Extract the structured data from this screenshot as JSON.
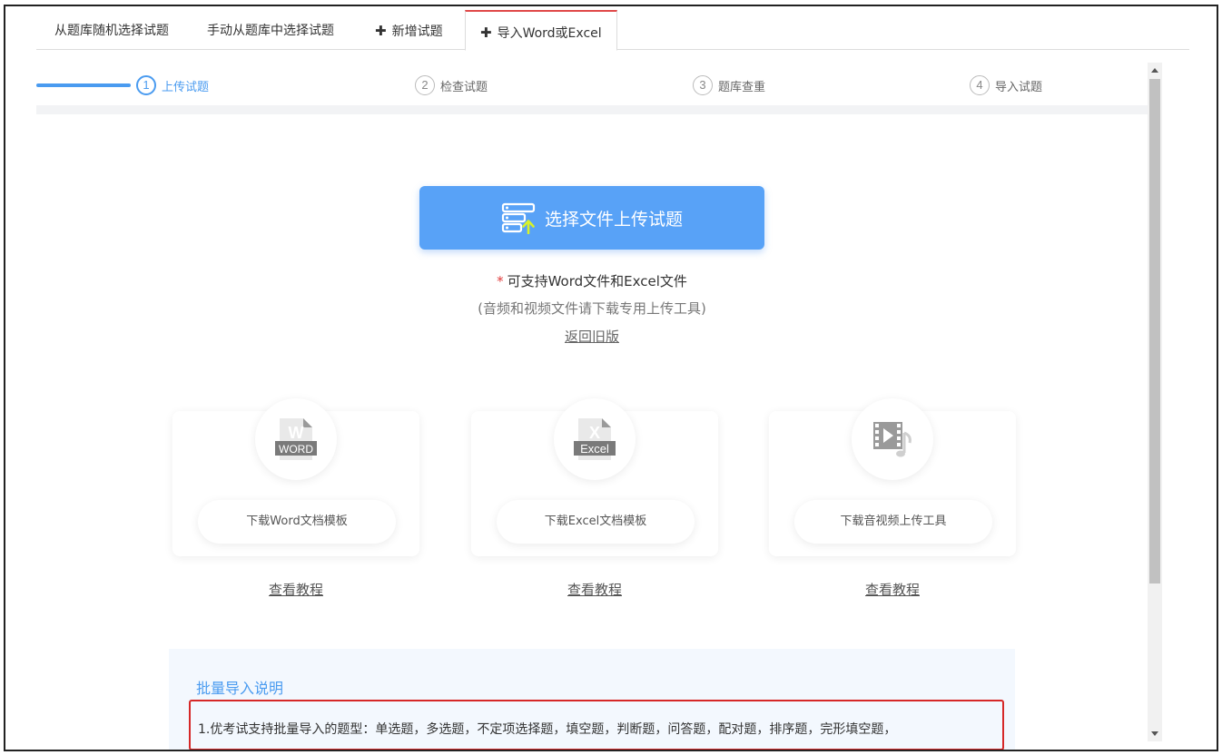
{
  "tabs": [
    {
      "label": "从题库随机选择试题",
      "plus": false
    },
    {
      "label": "手动从题库中选择试题",
      "plus": false
    },
    {
      "label": "新增试题",
      "plus": true
    },
    {
      "label": "导入Word或Excel",
      "plus": true,
      "active": true
    }
  ],
  "steps": [
    {
      "num": "1",
      "label": "上传试题",
      "active": true
    },
    {
      "num": "2",
      "label": "检查试题"
    },
    {
      "num": "3",
      "label": "题库查重"
    },
    {
      "num": "4",
      "label": "导入试题"
    }
  ],
  "upload": {
    "button_label": "选择文件上传试题",
    "hint_star": "*",
    "hint": "可支持Word文件和Excel文件",
    "hint_sub": "(音频和视频文件请下载专用上传工具)",
    "old_version_link": "返回旧版"
  },
  "cards": [
    {
      "icon": "word-file-icon",
      "icon_text": "WORD",
      "button": "下载Word文档模板",
      "tutorial": "查看教程"
    },
    {
      "icon": "excel-file-icon",
      "icon_text": "Excel",
      "button": "下载Excel文档模板",
      "tutorial": "查看教程"
    },
    {
      "icon": "video-audio-icon",
      "button": "下载音视频上传工具",
      "tutorial": "查看教程"
    }
  ],
  "batch": {
    "title": "批量导入说明",
    "text": "1.优考试支持批量导入的题型：单选题，多选题，不定项选择题，填空题，判断题，问答题，配对题，排序题，完形填空题，"
  },
  "colors": {
    "accent": "#4a9bf0",
    "button": "#58a2f7",
    "active_tab_border": "#e04848",
    "highlight_box": "#d62828"
  }
}
